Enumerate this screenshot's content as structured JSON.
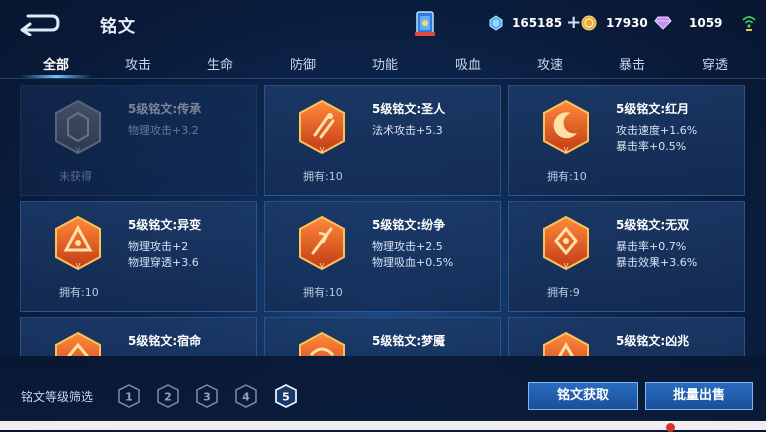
{
  "header": {
    "title": "铭文",
    "currencies": {
      "diamond": "165185",
      "gold": "17930",
      "gem": "1059"
    }
  },
  "tabs": [
    {
      "label": "全部",
      "active": true
    },
    {
      "label": "攻击",
      "active": false
    },
    {
      "label": "生命",
      "active": false
    },
    {
      "label": "防御",
      "active": false
    },
    {
      "label": "功能",
      "active": false
    },
    {
      "label": "吸血",
      "active": false
    },
    {
      "label": "攻速",
      "active": false
    },
    {
      "label": "暴击",
      "active": false
    },
    {
      "label": "穿透",
      "active": false
    }
  ],
  "cards": [
    {
      "name": "5级铭文:传承",
      "stat1": "物理攻击+3.2",
      "stat2": "",
      "owned": "未获得",
      "locked": true,
      "icon": "heritage-emblem-icon"
    },
    {
      "name": "5级铭文:圣人",
      "stat1": "法术攻击+5.3",
      "stat2": "",
      "owned": "拥有:10",
      "locked": false,
      "icon": "sage-emblem-icon"
    },
    {
      "name": "5级铭文:红月",
      "stat1": "攻击速度+1.6%",
      "stat2": "暴击率+0.5%",
      "owned": "拥有:10",
      "locked": false,
      "icon": "red-moon-emblem-icon"
    },
    {
      "name": "5级铭文:异变",
      "stat1": "物理攻击+2",
      "stat2": "物理穿透+3.6",
      "owned": "拥有:10",
      "locked": false,
      "icon": "mutation-emblem-icon"
    },
    {
      "name": "5级铭文:纷争",
      "stat1": "物理攻击+2.5",
      "stat2": "物理吸血+0.5%",
      "owned": "拥有:10",
      "locked": false,
      "icon": "strife-emblem-icon"
    },
    {
      "name": "5级铭文:无双",
      "stat1": "暴击率+0.7%",
      "stat2": "暴击效果+3.6%",
      "owned": "拥有:9",
      "locked": false,
      "icon": "peerless-emblem-icon"
    },
    {
      "name": "5级铭文:宿命",
      "stat1": "",
      "stat2": "",
      "owned": "",
      "locked": false,
      "icon": "fate-emblem-icon"
    },
    {
      "name": "5级铭文:梦魇",
      "stat1": "",
      "stat2": "",
      "owned": "",
      "locked": false,
      "icon": "nightmare-emblem-icon"
    },
    {
      "name": "5级铭文:凶兆",
      "stat1": "",
      "stat2": "",
      "owned": "",
      "locked": false,
      "icon": "omen-emblem-icon"
    }
  ],
  "footer": {
    "filter_label": "铭文等级筛选",
    "levels": [
      "1",
      "2",
      "3",
      "4",
      "5"
    ],
    "selected_level": "5",
    "get_button": "铭文获取",
    "sell_button": "批量出售"
  },
  "colors": {
    "accent": "#6cc4ff",
    "emblem_orange": "#e0521e",
    "emblem_gold": "#f3b64a"
  }
}
